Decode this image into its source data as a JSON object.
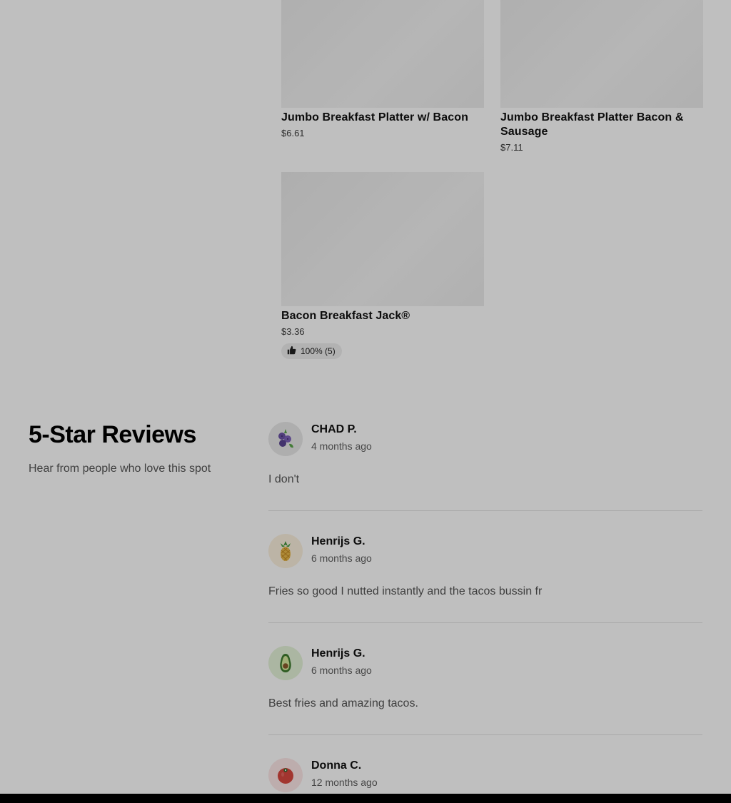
{
  "menu_items": [
    {
      "name": "Jumbo Breakfast Platter w/ Bacon",
      "price": "$6.61"
    },
    {
      "name": "Jumbo Breakfast Platter Bacon & Sausage",
      "price": "$7.11"
    },
    {
      "name": "Bacon Breakfast Jack®",
      "price": "$3.36",
      "rating": "100% (5)",
      "rating_icon": "thumbs-up-icon"
    }
  ],
  "reviews_section": {
    "title": "5-Star Reviews",
    "subtitle": "Hear from people who love this spot"
  },
  "reviews": [
    {
      "name": "CHAD P.",
      "date": "4 months ago",
      "text": "I don't",
      "avatar_icon": "blueberries-icon",
      "avatar_bg": "#e8e8e8"
    },
    {
      "name": "Henrijs G.",
      "date": "6 months ago",
      "text": "Fries so good I nutted instantly and the tacos bussin fr",
      "avatar_icon": "pineapple-icon",
      "avatar_bg": "#fbf1de"
    },
    {
      "name": "Henrijs G.",
      "date": "6 months ago",
      "text": "Best fries and amazing tacos.",
      "avatar_icon": "avocado-icon",
      "avatar_bg": "#e4f3d8"
    },
    {
      "name": "Donna C.",
      "date": "12 months ago",
      "text": "",
      "avatar_icon": "tomato-icon",
      "avatar_bg": "#fde7e7"
    }
  ],
  "colors": {
    "overlay": "rgba(0,0,0,0.25)",
    "text_primary": "#000000",
    "text_secondary": "#545454"
  }
}
